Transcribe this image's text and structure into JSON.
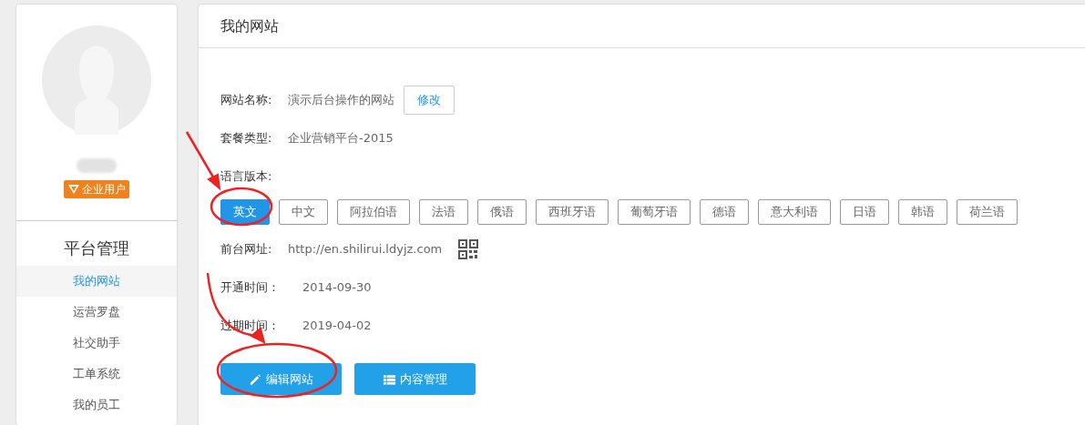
{
  "sidebar": {
    "badge": "企业用户",
    "section_title": "平台管理",
    "items": [
      {
        "label": "我的网站",
        "selected": true
      },
      {
        "label": "运营罗盘",
        "selected": false
      },
      {
        "label": "社交助手",
        "selected": false
      },
      {
        "label": "工单系统",
        "selected": false
      },
      {
        "label": "我的员工",
        "selected": false
      }
    ]
  },
  "main": {
    "title": "我的网站",
    "site_name": {
      "label": "网站名称:",
      "value": "演示后台操作的网站",
      "button": "修改"
    },
    "plan": {
      "label": "套餐类型:",
      "value": "企业营销平台-2015"
    },
    "languages": {
      "label": "语言版本:",
      "options": [
        {
          "label": "英文",
          "selected": true
        },
        {
          "label": "中文",
          "selected": false
        },
        {
          "label": "阿拉伯语",
          "selected": false
        },
        {
          "label": "法语",
          "selected": false
        },
        {
          "label": "俄语",
          "selected": false
        },
        {
          "label": "西班牙语",
          "selected": false
        },
        {
          "label": "葡萄牙语",
          "selected": false
        },
        {
          "label": "德语",
          "selected": false
        },
        {
          "label": "意大利语",
          "selected": false
        },
        {
          "label": "日语",
          "selected": false
        },
        {
          "label": "韩语",
          "selected": false
        },
        {
          "label": "荷兰语",
          "selected": false
        }
      ]
    },
    "url": {
      "label": "前台网址:",
      "value": "http://en.shilirui.ldyjz.com"
    },
    "opened": {
      "label": "开通时间：",
      "value": "2014-09-30"
    },
    "expires": {
      "label": "过期时间：",
      "value": "2019-04-02"
    },
    "actions": [
      {
        "kind": "edit",
        "label": "编辑网站"
      },
      {
        "kind": "list",
        "label": "内容管理"
      }
    ]
  }
}
